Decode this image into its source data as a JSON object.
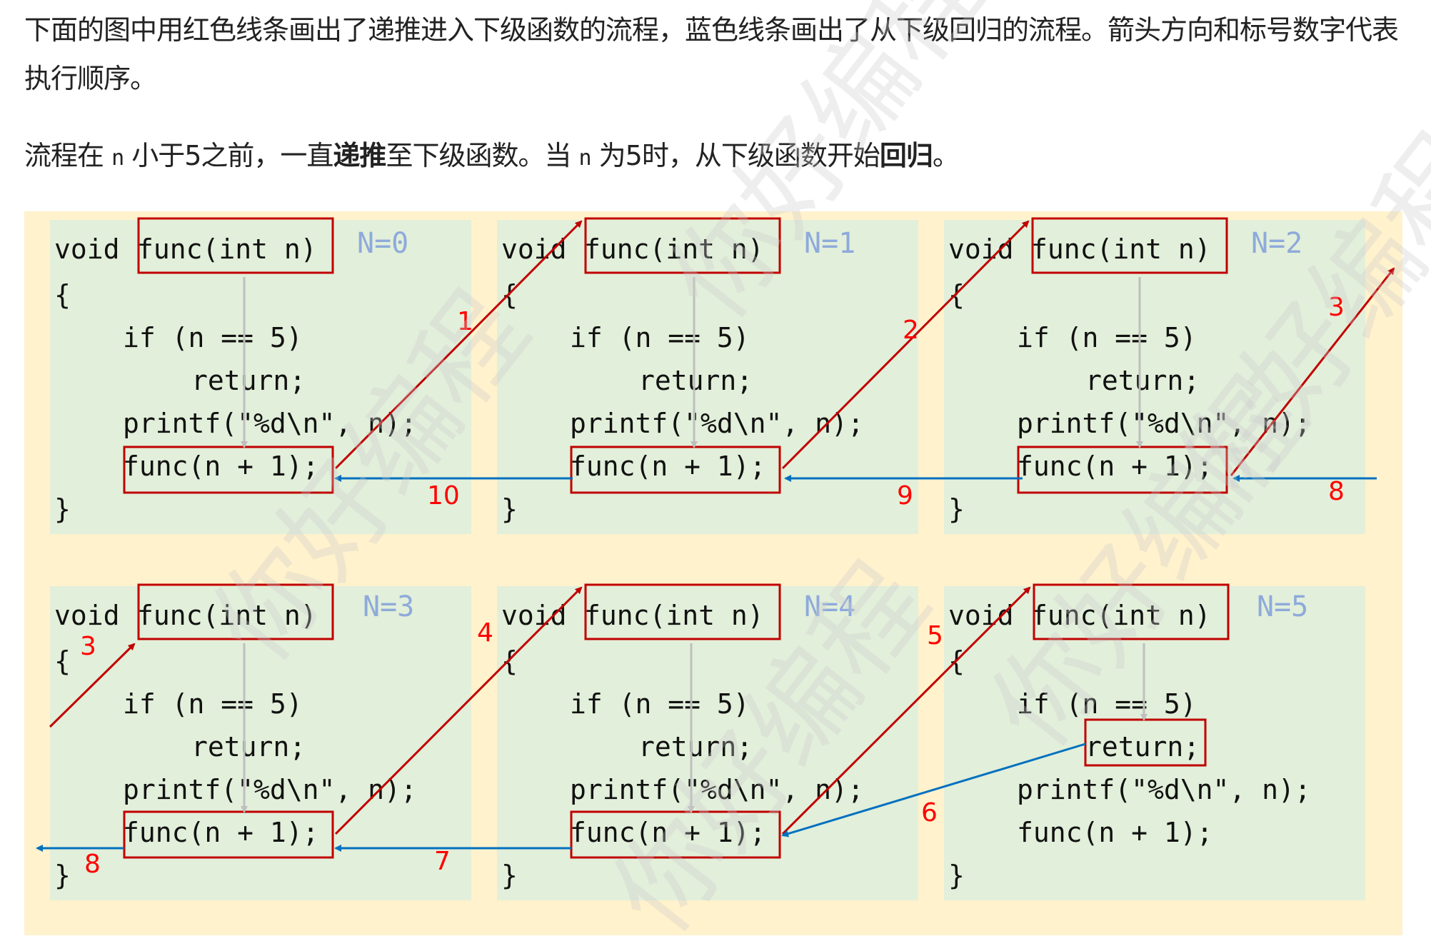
{
  "article": {
    "para1": "下面的图中用红色线条画出了递推进入下级函数的流程，蓝色线条画出了从下级回归的流程。箭头方向和标号数字代表执行顺序。",
    "para2_a": "流程在 ",
    "para2_code1": "n",
    "para2_b": " 小于5之前，一直",
    "para2_bold1": "递推",
    "para2_c": "至下级函数。当 ",
    "para2_code2": "n",
    "para2_d": " 为5时，从下级函数开始",
    "para2_bold2": "回归",
    "para2_e": "。"
  },
  "diagram": {
    "code": {
      "void": "void",
      "signature": "func(int n)",
      "open_brace": "{",
      "if_line": "if (n == 5)",
      "return_line": "return;",
      "printf_line": "printf(\"%d\\n\", n);",
      "call_line": "func(n + 1);",
      "close_brace": "}"
    },
    "panels": [
      {
        "label": "N=0"
      },
      {
        "label": "N=1"
      },
      {
        "label": "N=2"
      },
      {
        "label": "N=3"
      },
      {
        "label": "N=4"
      },
      {
        "label": "N=5"
      }
    ],
    "colors": {
      "recursion_arrow": "#c00000",
      "return_arrow": "#0070c0",
      "highlight_box": "#c00000",
      "flow_line": "#bfbfbf",
      "step_number": "#ff0000",
      "panel_bg": "#e2efda",
      "diagram_bg": "#fff2cc",
      "n_label": "#8eaadb"
    },
    "step_numbers": [
      "1",
      "2",
      "3",
      "3",
      "4",
      "5",
      "6",
      "7",
      "8",
      "8",
      "9",
      "10"
    ]
  },
  "watermark": {
    "text": "你好编程"
  }
}
